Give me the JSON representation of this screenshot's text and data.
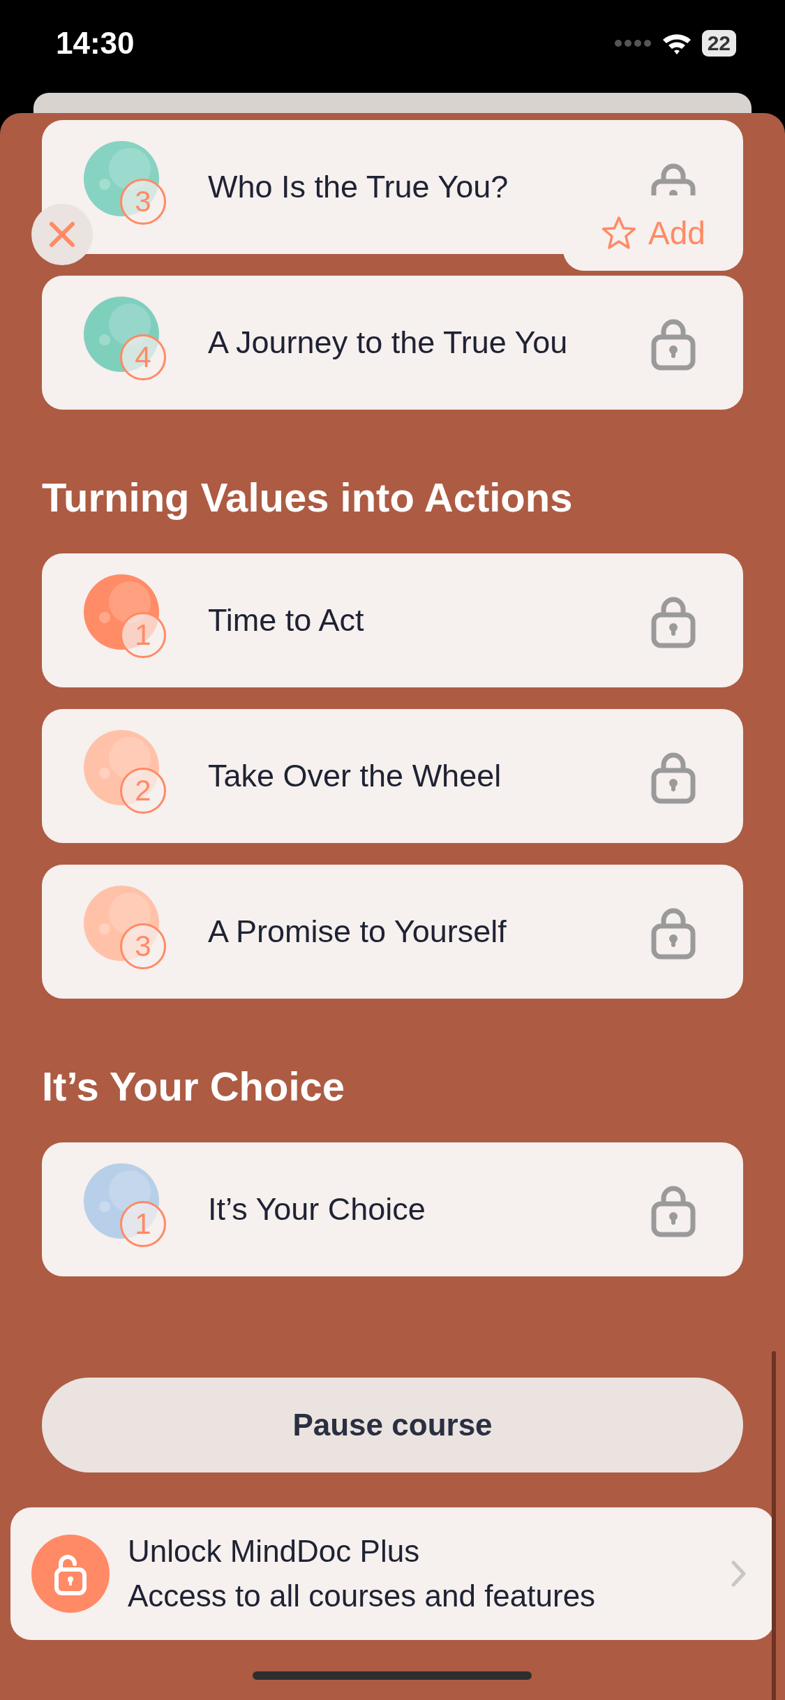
{
  "status_bar": {
    "time": "14:30",
    "battery": "22"
  },
  "sections": [
    {
      "lessons": [
        {
          "number": "3",
          "title": "Who Is the True You?",
          "color": "#86d3c2",
          "locked": true
        },
        {
          "number": "4",
          "title": "A Journey to the True You",
          "color": "#7fcfbd",
          "locked": true
        }
      ]
    },
    {
      "title": "Turning Values into Actions",
      "lessons": [
        {
          "number": "1",
          "title": "Time to Act",
          "color": "#ff8c66",
          "locked": true
        },
        {
          "number": "2",
          "title": "Take Over the Wheel",
          "color": "#ffc2a8",
          "locked": true
        },
        {
          "number": "3",
          "title": "A Promise to Yourself",
          "color": "#ffc2a8",
          "locked": true
        }
      ]
    },
    {
      "title": "It’s Your Choice",
      "lessons": [
        {
          "number": "1",
          "title": "It’s Your Choice",
          "color": "#b7cfe8",
          "locked": true
        }
      ]
    }
  ],
  "context_menu": {
    "action": "Add"
  },
  "pause_button": "Pause course",
  "upsell": {
    "title": "Unlock MindDoc Plus",
    "subtitle": "Access to all courses and features"
  }
}
